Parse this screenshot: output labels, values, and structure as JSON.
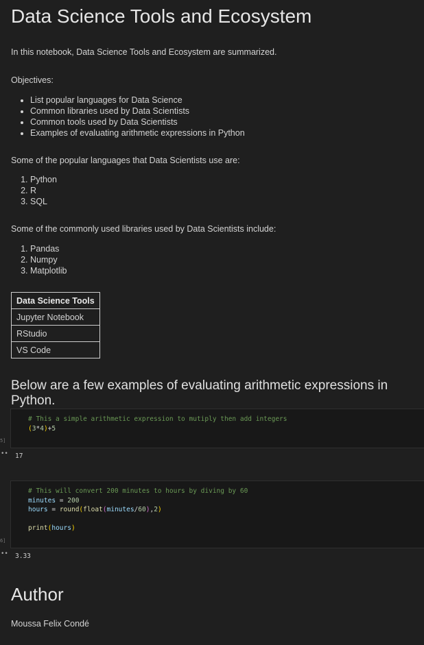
{
  "title": "Data Science Tools and Ecosystem",
  "intro": "In this notebook, Data Science Tools and Ecosystem are summarized.",
  "objectives_heading": "Objectives:",
  "objectives": [
    "List popular languages for Data Science",
    "Common libraries used by Data Scientists",
    "Common tools used by Data Scientists",
    "Examples of evaluating arithmetic expressions in Python"
  ],
  "languages_heading": "Some of the popular languages that Data Scientists use are:",
  "languages": [
    "Python",
    "R",
    "SQL"
  ],
  "libraries_heading": "Some of the commonly used libraries used by Data Scientists include:",
  "libraries": [
    "Pandas",
    "Numpy",
    "Matplotlib"
  ],
  "tools_table": {
    "header": "Data Science Tools",
    "rows": [
      "Jupyter Notebook",
      "RStudio",
      "VS Code"
    ]
  },
  "examples_heading": "Below are a few examples of evaluating arithmetic expressions in Python.",
  "cell1": {
    "comment": "# This a simple arithmetic expression to mutiply then add integers",
    "code": "(3*4)+5",
    "exec_count": "5]",
    "output_marker": "••",
    "output": "17"
  },
  "cell2": {
    "comment": "# This will convert 200 minutes to hours by diving by 60",
    "line1": "minutes = 200",
    "line2": "hours = round(float(minutes/60),2)",
    "line3": "print(hours)",
    "exec_count": "6]",
    "output_marker": "••",
    "output": "3.33"
  },
  "author_heading": "Author",
  "author_name": "Moussa Felix Condé",
  "colors": {
    "background": "#1f1f1f",
    "code_cell": "#181818",
    "comment": "#6a9955",
    "variable": "#9cdcfe",
    "number": "#b5cea8",
    "function": "#dcdcaa",
    "bracket": "#ffd700"
  }
}
